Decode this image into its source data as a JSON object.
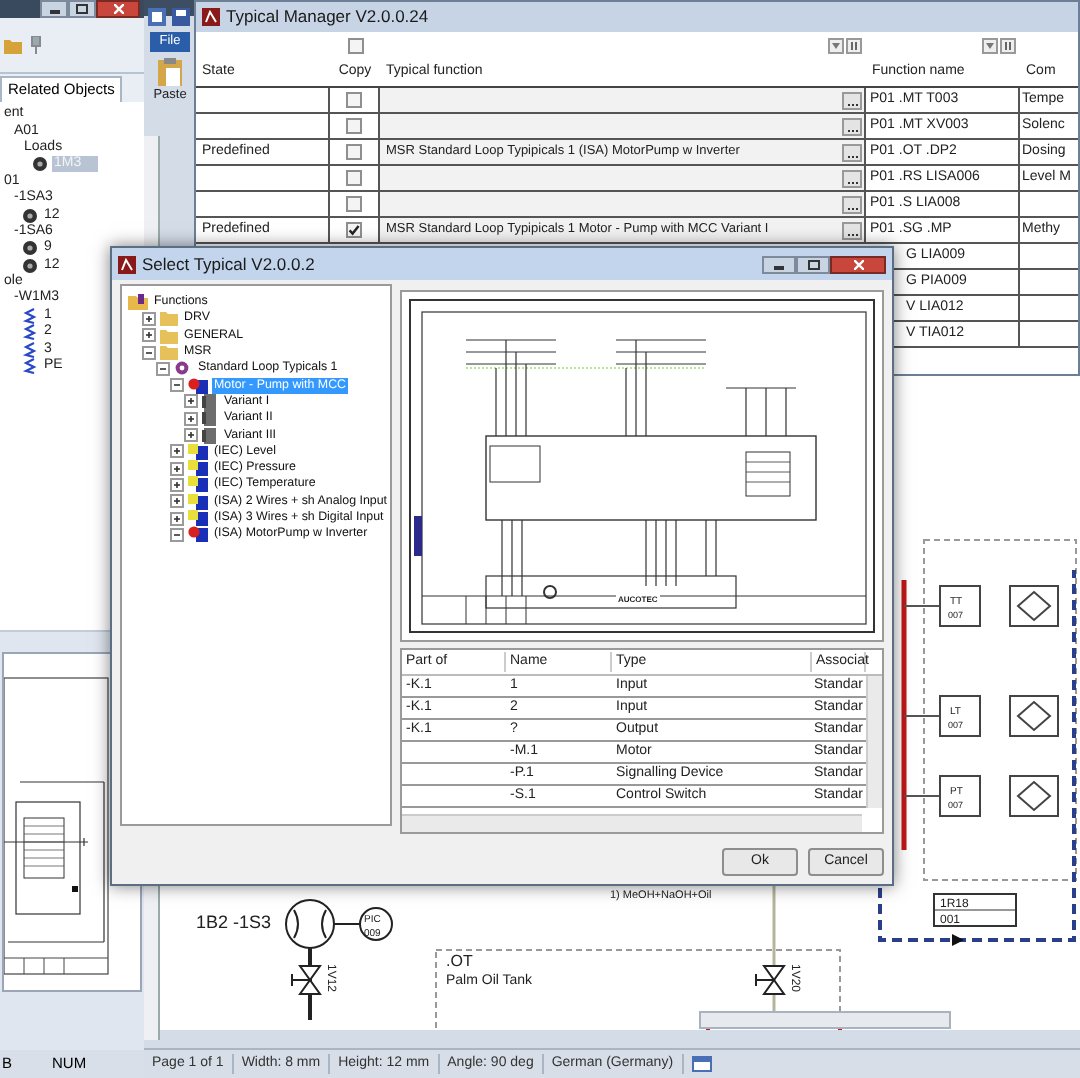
{
  "left_app": {
    "tab": "Related Objects",
    "tree": [
      {
        "label": "ent",
        "selected": false,
        "children": [
          {
            "label": "A01",
            "selected": false,
            "children": [
              {
                "label": "Loads",
                "selected": false,
                "children": [
                  {
                    "label": "1M3",
                    "kind": "device",
                    "selected": true
                  }
                ]
              }
            ]
          }
        ]
      },
      {
        "label": "01",
        "selected": false,
        "children": [
          {
            "label": "-1SA3",
            "selected": false,
            "children": [
              {
                "label": "12",
                "kind": "device",
                "selected": false
              }
            ]
          },
          {
            "label": "-1SA6",
            "selected": false,
            "children": [
              {
                "label": "9",
                "kind": "device",
                "selected": false
              },
              {
                "label": "12",
                "kind": "device",
                "selected": false
              }
            ]
          }
        ]
      },
      {
        "label": "ole",
        "selected": false,
        "children": [
          {
            "label": "-W1M3",
            "selected": false,
            "children": [
              {
                "label": "1",
                "kind": "wire",
                "selected": false
              },
              {
                "label": "2",
                "kind": "wire",
                "selected": false
              },
              {
                "label": "3",
                "kind": "wire",
                "selected": false
              },
              {
                "label": "PE",
                "kind": "wire",
                "selected": false
              }
            ]
          }
        ]
      }
    ],
    "status": [
      "B",
      "NUM"
    ]
  },
  "main_app": {
    "ribbon": {
      "file_tab": "File",
      "paste_button": "Paste"
    },
    "canvas": {
      "sensor": {
        "label": "1B2 -1S3"
      },
      "controller": {
        "tag": "PIC",
        "number": "009"
      },
      "valves": [
        {
          "label": "1V12"
        },
        {
          "label": "1V20"
        }
      ],
      "tank": {
        "name": ".OT",
        "description": "Palm Oil Tank"
      },
      "pipe_label": "1) MeOH+NaOH+Oil",
      "instruments": [
        {
          "tag": "TT",
          "number": "007"
        },
        {
          "tag": "LT",
          "number": "007"
        },
        {
          "tag": "PT",
          "number": "007"
        }
      ],
      "reference": {
        "label": "1R18",
        "number": "001"
      }
    },
    "status_bar": [
      "Page 1 of 1",
      "Width: 8 mm",
      "Height: 12 mm",
      "Angle: 90 deg",
      "German (Germany)"
    ]
  },
  "typical_manager": {
    "title": "Typical Manager V2.0.0.24",
    "select_all": false,
    "columns": [
      "State",
      "Copy",
      "Typical function",
      "Function name",
      "Com"
    ],
    "rows": [
      {
        "kind": "full",
        "copy": false,
        "function_name": "P01 .MT T003",
        "comment": "Tempe"
      },
      {
        "kind": "full",
        "copy": false,
        "function_name": "P01 .MT XV003",
        "comment": "Solenc"
      },
      {
        "kind": "full",
        "state": "Predefined",
        "copy": false,
        "typical_function": "MSR Standard Loop Typipicals 1 (ISA) MotorPump w Inverter",
        "function_name": "P01 .OT .DP2",
        "comment": "Dosing"
      },
      {
        "kind": "full",
        "copy": false,
        "function_name": "P01 .RS LISA006",
        "comment": "Level M"
      },
      {
        "kind": "full",
        "copy": false,
        "function_name": "P01 .S LIA008"
      },
      {
        "kind": "full",
        "state": "Predefined",
        "copy": true,
        "typical_function": "MSR Standard Loop Typipicals 1 Motor - Pump with MCC Variant I",
        "function_name": "P01 .SG .MP",
        "comment": "Methy"
      },
      {
        "kind": "partial",
        "function_name": "G LIA009"
      },
      {
        "kind": "partial",
        "function_name": "G PIA009"
      },
      {
        "kind": "partial",
        "function_name": "V LIA012"
      },
      {
        "kind": "partial",
        "function_name": "V TIA012"
      }
    ]
  },
  "select_typical": {
    "title": "Select Typical V2.0.0.2",
    "tree": [
      {
        "label": "Functions",
        "kind": "root",
        "selected": false,
        "children": [
          {
            "label": "DRV",
            "kind": "folder",
            "expanded": false,
            "selected": false
          },
          {
            "label": "GENERAL",
            "kind": "folder",
            "expanded": false,
            "selected": false
          },
          {
            "label": "MSR",
            "kind": "folder",
            "expanded": true,
            "selected": false,
            "children": [
              {
                "label": "Standard Loop Typicals 1",
                "kind": "library",
                "expanded": true,
                "selected": false,
                "children": [
                  {
                    "label": "Motor - Pump with MCC",
                    "kind": "motor",
                    "expanded": true,
                    "selected": true,
                    "children": [
                      {
                        "label": "Variant I",
                        "kind": "variant",
                        "expanded": false,
                        "selected": false
                      },
                      {
                        "label": "Variant II",
                        "kind": "variant",
                        "expanded": false,
                        "selected": false
                      },
                      {
                        "label": "Variant III",
                        "kind": "variant",
                        "expanded": false,
                        "selected": false
                      }
                    ]
                  },
                  {
                    "label": "(IEC) Level",
                    "kind": "signal",
                    "expanded": false,
                    "selected": false
                  },
                  {
                    "label": "(IEC) Pressure",
                    "kind": "signal",
                    "expanded": false,
                    "selected": false
                  },
                  {
                    "label": "(IEC) Temperature",
                    "kind": "signal",
                    "expanded": false,
                    "selected": false
                  },
                  {
                    "label": "(ISA) 2 Wires + sh Analog Input",
                    "kind": "signal",
                    "expanded": false,
                    "selected": false
                  },
                  {
                    "label": "(ISA) 3 Wires + sh Digital Input",
                    "kind": "signal",
                    "expanded": false,
                    "selected": false
                  },
                  {
                    "label": "(ISA) MotorPump w Inverter",
                    "kind": "motor",
                    "expanded": true,
                    "selected": false
                  }
                ]
              }
            ]
          }
        ]
      }
    ],
    "preview": {
      "logo": "AUCOTEC"
    },
    "parts_table": {
      "columns": [
        "Part of",
        "Name",
        "Type",
        "Associat"
      ],
      "rows": [
        {
          "part_of": "-K.1",
          "name": "1",
          "type": "Input",
          "associated": "Standar"
        },
        {
          "part_of": "-K.1",
          "name": "2",
          "type": "Input",
          "associated": "Standar"
        },
        {
          "part_of": "-K.1",
          "name": "?",
          "type": "Output",
          "associated": "Standar"
        },
        {
          "name": "-M.1",
          "type": "Motor",
          "associated": "Standar"
        },
        {
          "name": "-P.1",
          "type": "Signalling Device",
          "associated": "Standar"
        },
        {
          "name": "-S.1",
          "type": "Control Switch",
          "associated": "Standar"
        }
      ]
    },
    "buttons": [
      "Ok",
      "Cancel"
    ]
  }
}
